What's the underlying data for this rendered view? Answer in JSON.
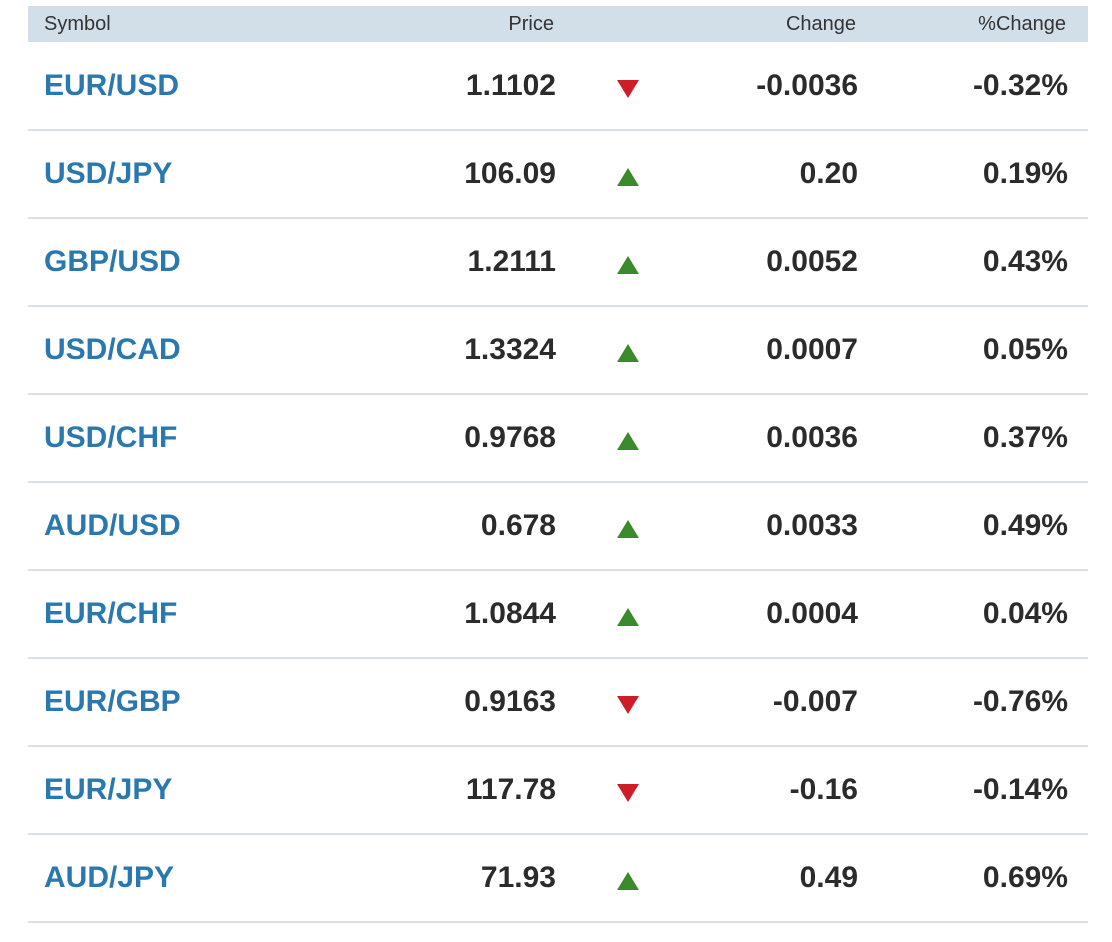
{
  "table": {
    "headers": {
      "symbol": "Symbol",
      "price": "Price",
      "change": "Change",
      "pct_change": "%Change"
    },
    "colors": {
      "up": "#3c8a2e",
      "down": "#cc1d29",
      "link": "#2a78b0",
      "header_bg": "#d3dfe8"
    },
    "rows": [
      {
        "symbol": "EUR/USD",
        "price": "1.1102",
        "direction": "down",
        "change": "-0.0036",
        "pct_change": "-0.32%"
      },
      {
        "symbol": "USD/JPY",
        "price": "106.09",
        "direction": "up",
        "change": "0.20",
        "pct_change": "0.19%"
      },
      {
        "symbol": "GBP/USD",
        "price": "1.2111",
        "direction": "up",
        "change": "0.0052",
        "pct_change": "0.43%"
      },
      {
        "symbol": "USD/CAD",
        "price": "1.3324",
        "direction": "up",
        "change": "0.0007",
        "pct_change": "0.05%"
      },
      {
        "symbol": "USD/CHF",
        "price": "0.9768",
        "direction": "up",
        "change": "0.0036",
        "pct_change": "0.37%"
      },
      {
        "symbol": "AUD/USD",
        "price": "0.678",
        "direction": "up",
        "change": "0.0033",
        "pct_change": "0.49%"
      },
      {
        "symbol": "EUR/CHF",
        "price": "1.0844",
        "direction": "up",
        "change": "0.0004",
        "pct_change": "0.04%"
      },
      {
        "symbol": "EUR/GBP",
        "price": "0.9163",
        "direction": "down",
        "change": "-0.007",
        "pct_change": "-0.76%"
      },
      {
        "symbol": "EUR/JPY",
        "price": "117.78",
        "direction": "down",
        "change": "-0.16",
        "pct_change": "-0.14%"
      },
      {
        "symbol": "AUD/JPY",
        "price": "71.93",
        "direction": "up",
        "change": "0.49",
        "pct_change": "0.69%"
      }
    ]
  }
}
